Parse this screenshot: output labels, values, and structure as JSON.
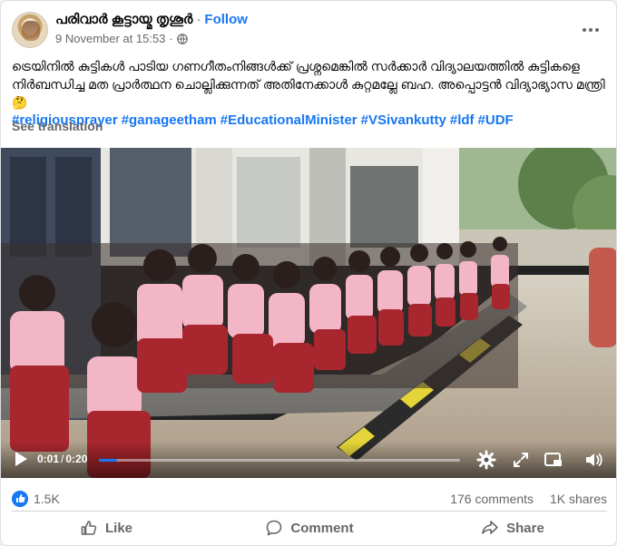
{
  "post": {
    "page_name": "പരിവാർ കൂട്ടായ്മ തൃശൂർ",
    "separator": "·",
    "follow_label": "Follow",
    "timestamp": "9 November at 15:53",
    "audience_icon": "globe-icon",
    "text_line": "ട്രെയിനിൽ കുട്ടികൾ പാടിയ ഗണഗീതംനിങ്ങൾക്ക് പ്രശ്നമെങ്കിൽ സർക്കാർ വിദ്യാലയത്തിൽ കുട്ടികളെ നിർബന്ധിച്ച മത പ്രാർത്ഥന ചൊല്ലിക്കുന്നത് അതിനേക്കാൾ കുറ്റമല്ലേ ബഹ. അപ്പൊട്ടൻ വിദ്യാഭ്യാസ മന്ത്രി 🤔",
    "hashtags": [
      "#religiousprayer",
      "#ganageetham",
      "#EducationalMinister",
      "#VSivankutty",
      "#ldf",
      "#UDF"
    ],
    "see_translation": "See translation"
  },
  "video": {
    "current_time": "0:01",
    "time_separator": "/",
    "duration": "0:20",
    "progress": 0.05,
    "accent": "#1877f2"
  },
  "stats": {
    "reactions": "1.5K",
    "comments": "176 comments",
    "shares": "1K shares"
  },
  "actions": {
    "like": "Like",
    "comment": "Comment",
    "share": "Share"
  },
  "colors": {
    "link": "#1877f2",
    "secondary_text": "#65676b",
    "uniform_shirt": "#f3b6c6",
    "uniform_skirt": "#a8262e"
  }
}
